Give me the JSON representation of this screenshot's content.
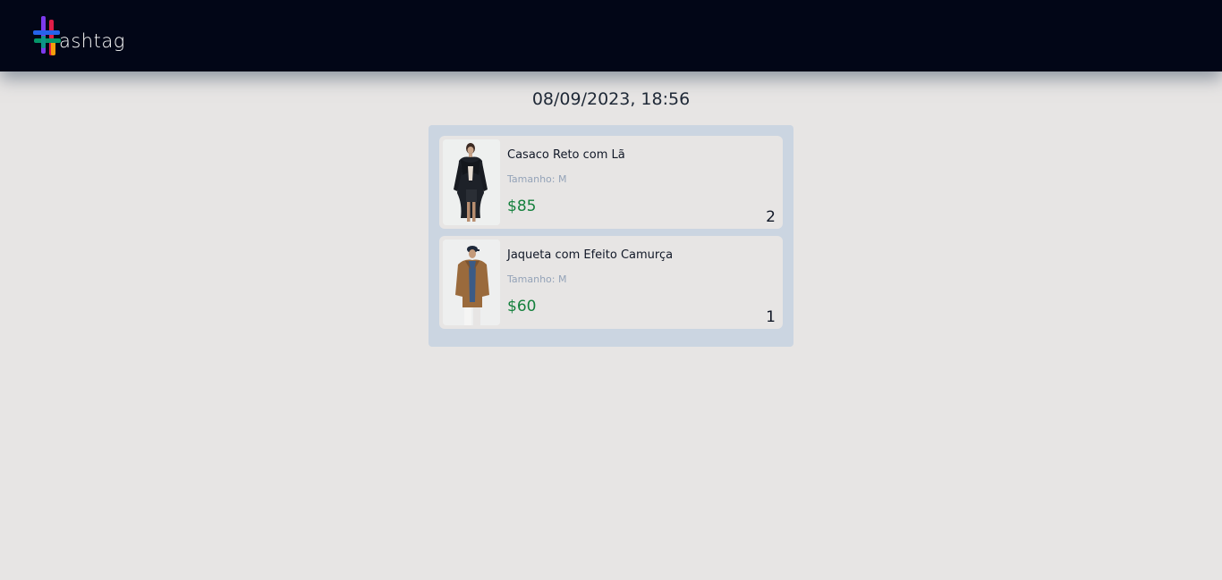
{
  "header": {
    "logo_text": "ashtag",
    "logo_icon": "hashtag-logo-icon"
  },
  "order": {
    "timestamp": "08/09/2023, 18:56"
  },
  "cart": {
    "items": [
      {
        "name": "Casaco Reto com Lã",
        "size": "Tamanho: M",
        "price": "$85",
        "quantity": "2",
        "image": "black-coat-product-image"
      },
      {
        "name": "Jaqueta com Efeito Camurça",
        "size": "Tamanho: M",
        "price": "$60",
        "quantity": "1",
        "image": "brown-suede-jacket-product-image"
      }
    ]
  },
  "colors": {
    "header_bg": "#020617",
    "page_bg": "#e7e5e4",
    "panel_bg": "#cbd5e1",
    "price": "#15803d"
  }
}
